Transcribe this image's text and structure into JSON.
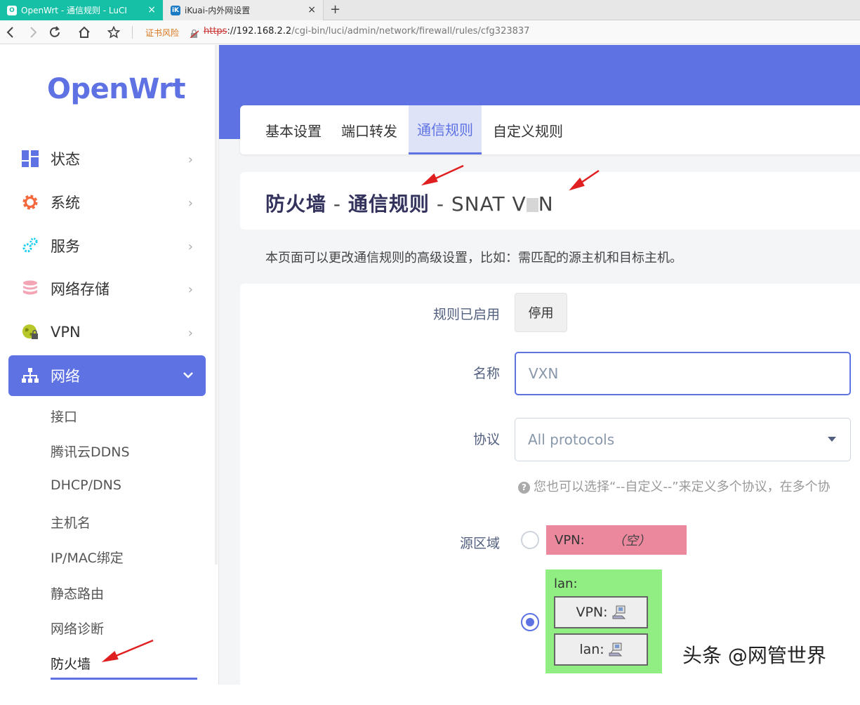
{
  "browser": {
    "tabs": [
      {
        "title": "OpenWrt - 通信规则 - LuCI",
        "favicon": "openwrt-icon",
        "active": true
      },
      {
        "title": "iKuai-内外网设置",
        "favicon": "ikuai-icon",
        "active": false
      }
    ],
    "cert_warning": "证书风险",
    "url_scheme": "https",
    "url_host": "://192.168.2.2",
    "url_path": "/cgi-bin/luci/admin/network/firewall/rules/cfg323837",
    "new_tab": "+",
    "close": "×"
  },
  "sidebar": {
    "logo": "OpenWrt",
    "menu": [
      {
        "label": "状态",
        "icon": "dashboard-icon"
      },
      {
        "label": "系统",
        "icon": "gear-icon"
      },
      {
        "label": "服务",
        "icon": "gears-icon"
      },
      {
        "label": "网络存储",
        "icon": "database-icon"
      },
      {
        "label": "VPN",
        "icon": "globe-lock-icon"
      },
      {
        "label": "网络",
        "icon": "network-icon",
        "active": true
      }
    ],
    "submenu": [
      "接口",
      "腾讯云DDNS",
      "DHCP/DNS",
      "主机名",
      "IP/MAC绑定",
      "静态路由",
      "网络诊断",
      "防火墙"
    ],
    "active_submenu": "防火墙"
  },
  "nav_tabs": [
    "基本设置",
    "端口转发",
    "通信规则",
    "自定义规则"
  ],
  "active_tab": "通信规则",
  "title": {
    "part1": "防火墙",
    "sep1": " - ",
    "part2": "通信规则",
    "sep2": " - ",
    "part3": "SNAT V",
    "part3_end": "N"
  },
  "description": "本页面可以更改通信规则的高级设置，比如：需匹配的源主机和目标主机。",
  "form": {
    "enabled_label": "规则已启用",
    "enabled_button": "停用",
    "name_label": "名称",
    "name_value": "VXN",
    "protocol_label": "协议",
    "protocol_value": "All protocols",
    "protocol_hint": "您也可以选择“--自定义--”来定义多个协议，在多个协",
    "source_zone_label": "源区域",
    "zones": {
      "vpn_label": "VPN:",
      "vpn_empty": "（空）",
      "lan_title": "lan:",
      "lan_children": [
        "VPN:",
        "lan:"
      ]
    }
  },
  "watermark": "头条 @网管世界",
  "colors": {
    "accent": "#5e72e4",
    "tab_green": "#16c0a6",
    "zone_vpn": "#ec889e",
    "zone_lan": "#90ee82",
    "arrow": "#e02020"
  }
}
